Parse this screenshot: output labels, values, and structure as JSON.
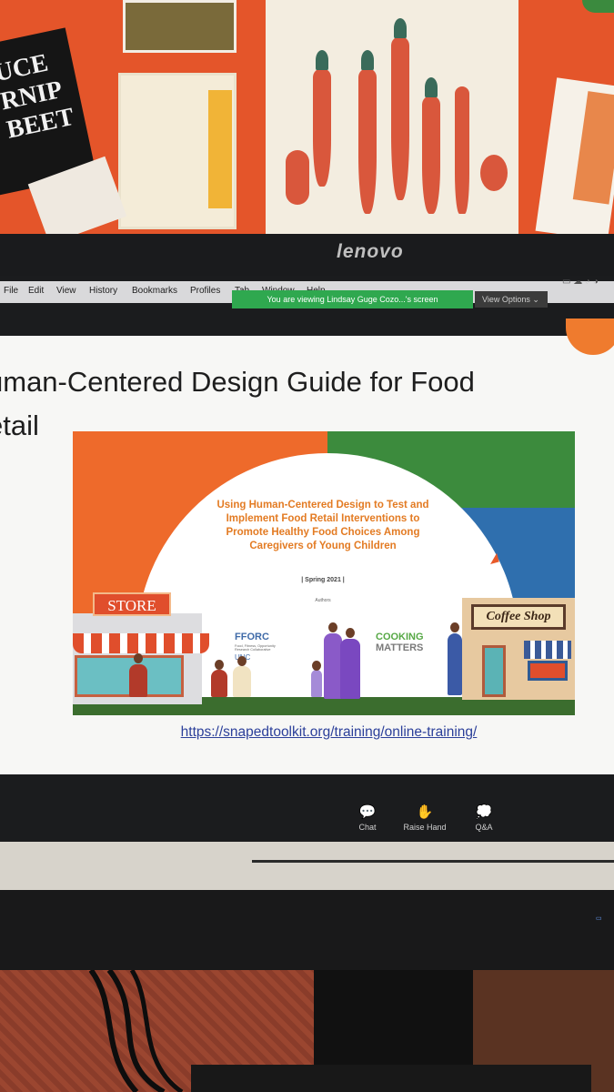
{
  "monitor": {
    "brand": "lenovo"
  },
  "menubar": {
    "items": [
      "File",
      "Edit",
      "View",
      "History",
      "Bookmarks",
      "Profiles",
      "Tab",
      "Window",
      "Help"
    ]
  },
  "zoom": {
    "share_banner": "You are viewing Lindsay Guge Cozo...'s screen",
    "view_options": "View Options ⌄",
    "toolbar": [
      {
        "label": "Chat",
        "icon": "chat-icon"
      },
      {
        "label": "Raise Hand",
        "icon": "raise-hand-icon"
      },
      {
        "label": "Q&A",
        "icon": "qa-icon"
      }
    ]
  },
  "slide": {
    "title": "uman-Centered Design Guide for Food etail",
    "title_line1": "uman-Centered Design Guide for Food",
    "title_line2": "etail",
    "link": "https://snapedtoolkit.org/training/online-training/",
    "cover": {
      "title": "Using Human-Centered Design to Test and Implement Food Retail Interventions to Promote Healthy Food Choices Among Caregivers of Young Children",
      "date": "| Spring 2021 |",
      "authors_label": "Authors",
      "store_sign": "STORE",
      "coffee_sign": "Coffee Shop",
      "ffc_logo": "FFORC",
      "ffc_sub": "Food, Fitness, Opportunity Research Collaborative",
      "unc_logo": "UNC",
      "cooking": "COOKING",
      "matters": "MATTERS"
    }
  },
  "wall": {
    "black_sign": "UCE RNIP BEET",
    "colors": {
      "wall": "#e4552a",
      "carrot": "#d9573c"
    }
  }
}
